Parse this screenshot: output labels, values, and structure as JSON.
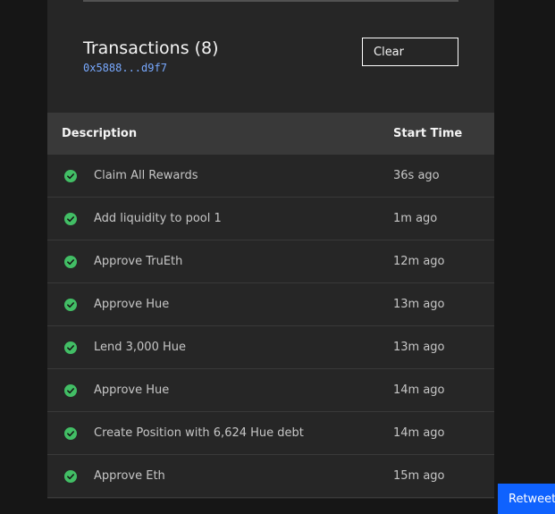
{
  "header": {
    "title": "Transactions (8)",
    "address": "0x5888...d9f7",
    "clear_label": "Clear"
  },
  "table": {
    "columns": {
      "description": "Description",
      "start_time": "Start Time"
    },
    "rows": [
      {
        "description": "Claim All Rewards",
        "start_time": "36s ago",
        "status": "success"
      },
      {
        "description": "Add liquidity to pool 1",
        "start_time": "1m ago",
        "status": "success"
      },
      {
        "description": "Approve TruEth",
        "start_time": "12m ago",
        "status": "success"
      },
      {
        "description": "Approve Hue",
        "start_time": "13m ago",
        "status": "success"
      },
      {
        "description": "Lend 3,000 Hue",
        "start_time": "13m ago",
        "status": "success"
      },
      {
        "description": "Approve Hue",
        "start_time": "14m ago",
        "status": "success"
      },
      {
        "description": "Create Position with 6,624 Hue debt",
        "start_time": "14m ago",
        "status": "success"
      },
      {
        "description": "Approve Eth",
        "start_time": "15m ago",
        "status": "success"
      }
    ]
  },
  "retweet_label": "Retweet",
  "colors": {
    "success": "#42be65",
    "accent": "#0f62fe",
    "address": "#78a9ff"
  },
  "icons": {
    "status": "checkmark-filled-icon"
  }
}
